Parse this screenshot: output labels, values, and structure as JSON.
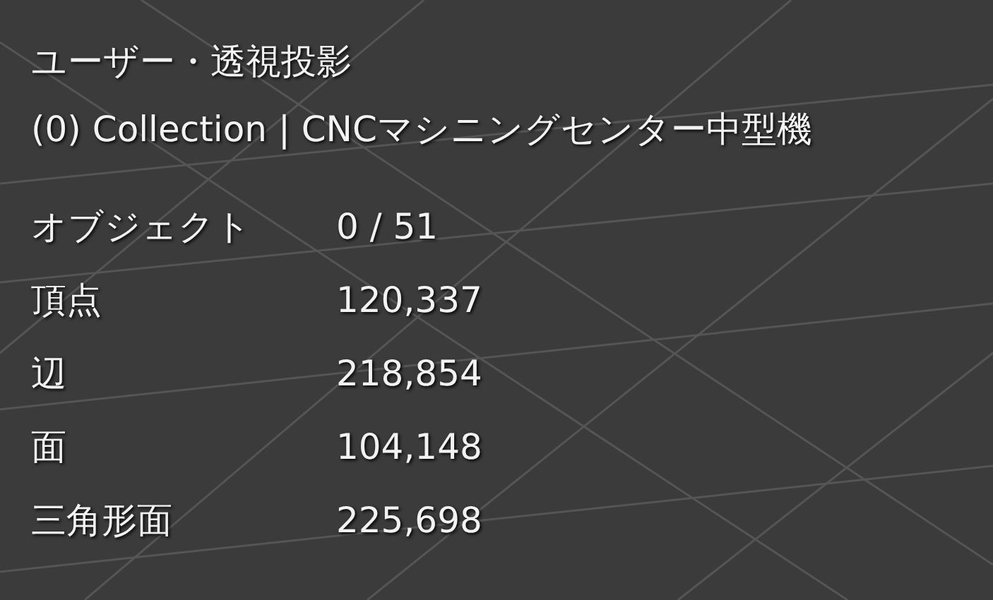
{
  "header": {
    "view_title": "ユーザー・透視投影",
    "collection": "(0) Collection | CNCマシニングセンター中型機"
  },
  "stats": [
    {
      "label": "オブジェクト",
      "value": "0 / 51"
    },
    {
      "label": "頂点",
      "value": "120,337"
    },
    {
      "label": "辺",
      "value": "218,854"
    },
    {
      "label": "面",
      "value": "104,148"
    },
    {
      "label": "三角形面",
      "value": "225,698"
    }
  ]
}
